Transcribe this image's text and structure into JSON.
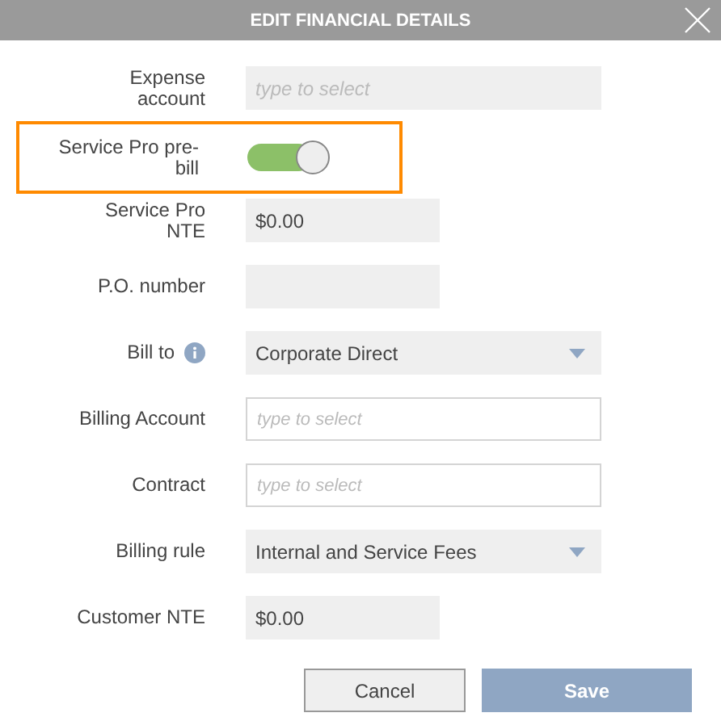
{
  "dialog": {
    "title": "EDIT FINANCIAL DETAILS"
  },
  "fields": [
    {
      "kind": "text",
      "label": "Expense account",
      "placeholder": "type to select",
      "wide": true
    },
    {
      "kind": "toggle",
      "label": "Service Pro pre-bill",
      "on": true,
      "highlighted": true
    },
    {
      "kind": "text",
      "label": "Service Pro NTE",
      "value": "$0.00",
      "wide": false
    },
    {
      "kind": "text",
      "label": "P.O. number",
      "wide": false
    },
    {
      "kind": "select",
      "label": "Bill to",
      "value": "Corporate Direct",
      "info": true
    },
    {
      "kind": "lookup",
      "label": "Billing Account",
      "placeholder": "type to select"
    },
    {
      "kind": "lookup",
      "label": "Contract",
      "placeholder": "type to select"
    },
    {
      "kind": "select",
      "label": "Billing rule",
      "value": "Internal and Service Fees"
    },
    {
      "kind": "text",
      "label": "Customer NTE",
      "value": "$0.00",
      "wide": false
    }
  ],
  "buttons": [
    {
      "label": "Cancel",
      "kind": "secondary"
    },
    {
      "label": "Save",
      "kind": "primary"
    }
  ]
}
